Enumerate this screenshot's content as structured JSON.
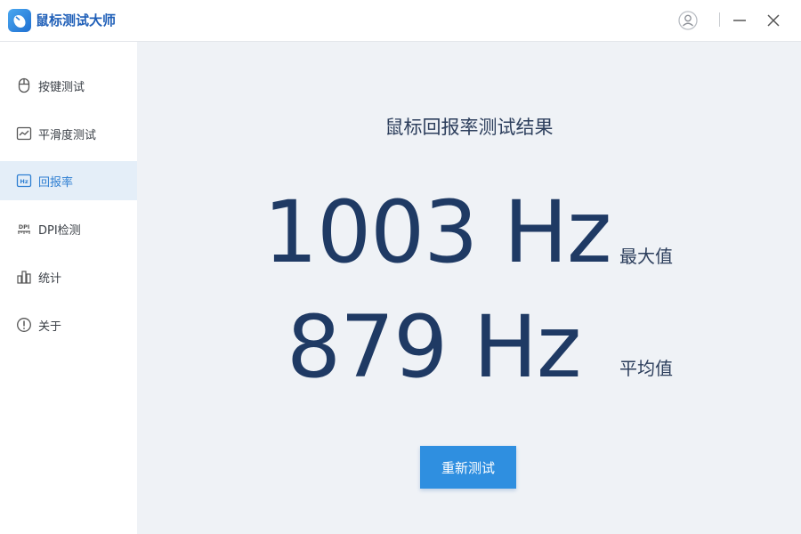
{
  "app": {
    "title": "鼠标测试大师"
  },
  "window_controls": {
    "user_icon": "user-icon",
    "minimize_icon": "minimize-icon",
    "close_icon": "close-icon"
  },
  "sidebar": {
    "items": [
      {
        "label": "按键测试",
        "icon": "mouse-icon",
        "active": false
      },
      {
        "label": "平滑度测试",
        "icon": "trend-chart-icon",
        "active": false
      },
      {
        "label": "回报率",
        "icon": "hz-icon",
        "active": true
      },
      {
        "label": "DPI检测",
        "icon": "dpi-icon",
        "active": false
      },
      {
        "label": "统计",
        "icon": "bar-chart-icon",
        "active": false
      },
      {
        "label": "关于",
        "icon": "info-icon",
        "active": false
      }
    ]
  },
  "main": {
    "title": "鼠标回报率测试结果",
    "max": {
      "value": "1003 Hz",
      "label": "最大值"
    },
    "avg": {
      "value": "879 Hz",
      "label": "平均值"
    },
    "retest_label": "重新测试"
  },
  "colors": {
    "accent": "#2f8fe0",
    "active_nav_bg": "#e4eef8",
    "value_text": "#1f3a64",
    "main_bg": "#eff2f6"
  }
}
